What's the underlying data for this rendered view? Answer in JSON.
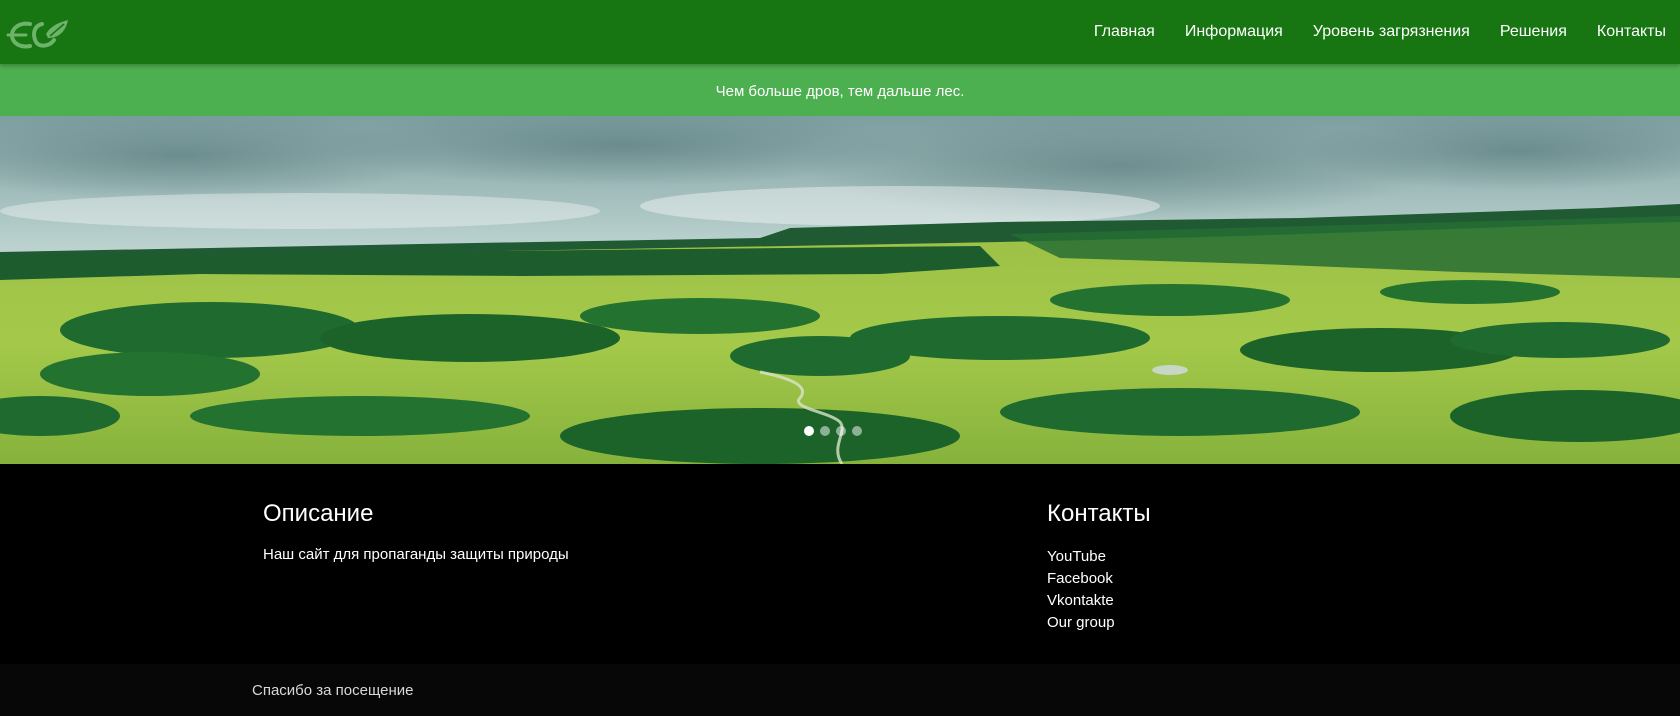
{
  "header": {
    "logo_text": "ECO",
    "nav": [
      "Главная",
      "Информация",
      "Уровень загрязнения",
      "Решения",
      "Контакты"
    ]
  },
  "quote": "Чем больше дров, тем дальше лес.",
  "carousel": {
    "slide_count": 4,
    "active_index": 0
  },
  "footer": {
    "description": {
      "title": "Описание",
      "text": "Наш сайт для пропаганды защиты природы"
    },
    "contacts": {
      "title": "Контакты",
      "links": [
        "YouTube",
        "Facebook",
        "Vkontakte",
        "Our group"
      ]
    },
    "copyright": "Спасибо за посещение"
  },
  "colors": {
    "header_bg": "#177612",
    "quote_bg": "#4caf50",
    "footer_bg": "#000000",
    "footer_bottom_bg": "#070707"
  }
}
